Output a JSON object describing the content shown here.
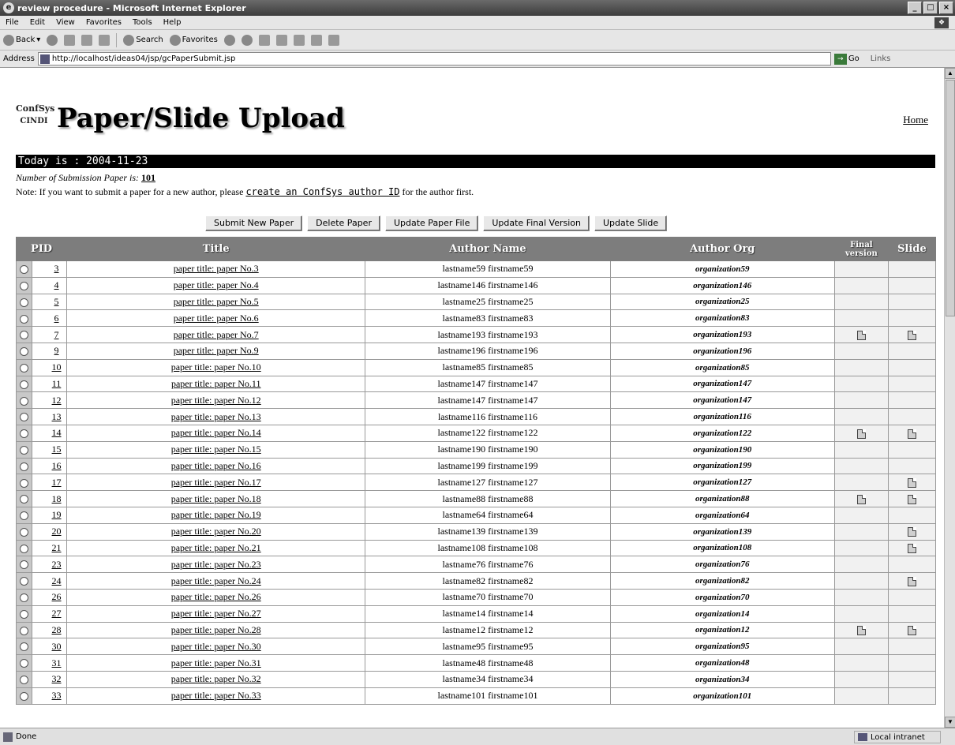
{
  "window": {
    "title": "review procedure - Microsoft Internet Explorer"
  },
  "menu": [
    "File",
    "Edit",
    "View",
    "Favorites",
    "Tools",
    "Help"
  ],
  "toolbar": {
    "back": "Back",
    "search": "Search",
    "favorites": "Favorites"
  },
  "address": {
    "label": "Address",
    "url": "http://localhost/ideas04/jsp/gcPaperSubmit.jsp",
    "go": "Go",
    "links": "Links"
  },
  "header": {
    "logo_line1": "ConfSys",
    "logo_line2": "CINDI",
    "title": "Paper/Slide Upload",
    "home": "Home"
  },
  "date_text": "Today is : 2004-11-23",
  "count": {
    "label": "Number of Submission Paper is:",
    "value": "101"
  },
  "note": {
    "prefix": "Note: If you want to submit a paper for a new author, please",
    "link": "create an ConfSys author ID",
    "suffix": "for the author first."
  },
  "buttons": [
    "Submit New Paper",
    "Delete Paper",
    "Update Paper File",
    "Update Final Version",
    "Update Slide"
  ],
  "table": {
    "headers": [
      "PID",
      "Title",
      "Author Name",
      "Author Org",
      "Final version",
      "Slide"
    ],
    "rows": [
      {
        "pid": "3",
        "title": "paper title: paper No.3",
        "author": "lastname59 firstname59",
        "org": "organization59",
        "final": false,
        "slide": false
      },
      {
        "pid": "4",
        "title": "paper title: paper No.4",
        "author": "lastname146 firstname146",
        "org": "organization146",
        "final": false,
        "slide": false
      },
      {
        "pid": "5",
        "title": "paper title: paper No.5",
        "author": "lastname25 firstname25",
        "org": "organization25",
        "final": false,
        "slide": false
      },
      {
        "pid": "6",
        "title": "paper title: paper No.6",
        "author": "lastname83 firstname83",
        "org": "organization83",
        "final": false,
        "slide": false
      },
      {
        "pid": "7",
        "title": "paper title: paper No.7",
        "author": "lastname193 firstname193",
        "org": "organization193",
        "final": true,
        "slide": true
      },
      {
        "pid": "9",
        "title": "paper title: paper No.9",
        "author": "lastname196 firstname196",
        "org": "organization196",
        "final": false,
        "slide": false
      },
      {
        "pid": "10",
        "title": "paper title: paper No.10",
        "author": "lastname85 firstname85",
        "org": "organization85",
        "final": false,
        "slide": false
      },
      {
        "pid": "11",
        "title": "paper title: paper No.11",
        "author": "lastname147 firstname147",
        "org": "organization147",
        "final": false,
        "slide": false
      },
      {
        "pid": "12",
        "title": "paper title: paper No.12",
        "author": "lastname147 firstname147",
        "org": "organization147",
        "final": false,
        "slide": false
      },
      {
        "pid": "13",
        "title": "paper title: paper No.13",
        "author": "lastname116 firstname116",
        "org": "organization116",
        "final": false,
        "slide": false
      },
      {
        "pid": "14",
        "title": "paper title: paper No.14",
        "author": "lastname122 firstname122",
        "org": "organization122",
        "final": true,
        "slide": true
      },
      {
        "pid": "15",
        "title": "paper title: paper No.15",
        "author": "lastname190 firstname190",
        "org": "organization190",
        "final": false,
        "slide": false
      },
      {
        "pid": "16",
        "title": "paper title: paper No.16",
        "author": "lastname199 firstname199",
        "org": "organization199",
        "final": false,
        "slide": false
      },
      {
        "pid": "17",
        "title": "paper title: paper No.17",
        "author": "lastname127 firstname127",
        "org": "organization127",
        "final": false,
        "slide": true
      },
      {
        "pid": "18",
        "title": "paper title: paper No.18",
        "author": "lastname88 firstname88",
        "org": "organization88",
        "final": true,
        "slide": true
      },
      {
        "pid": "19",
        "title": "paper title: paper No.19",
        "author": "lastname64 firstname64",
        "org": "organization64",
        "final": false,
        "slide": false
      },
      {
        "pid": "20",
        "title": "paper title: paper No.20",
        "author": "lastname139 firstname139",
        "org": "organization139",
        "final": false,
        "slide": true
      },
      {
        "pid": "21",
        "title": "paper title: paper No.21",
        "author": "lastname108 firstname108",
        "org": "organization108",
        "final": false,
        "slide": true
      },
      {
        "pid": "23",
        "title": "paper title: paper No.23",
        "author": "lastname76 firstname76",
        "org": "organization76",
        "final": false,
        "slide": false
      },
      {
        "pid": "24",
        "title": "paper title: paper No.24",
        "author": "lastname82 firstname82",
        "org": "organization82",
        "final": false,
        "slide": true
      },
      {
        "pid": "26",
        "title": "paper title: paper No.26",
        "author": "lastname70 firstname70",
        "org": "organization70",
        "final": false,
        "slide": false
      },
      {
        "pid": "27",
        "title": "paper title: paper No.27",
        "author": "lastname14 firstname14",
        "org": "organization14",
        "final": false,
        "slide": false
      },
      {
        "pid": "28",
        "title": "paper title: paper No.28",
        "author": "lastname12 firstname12",
        "org": "organization12",
        "final": true,
        "slide": true
      },
      {
        "pid": "30",
        "title": "paper title: paper No.30",
        "author": "lastname95 firstname95",
        "org": "organization95",
        "final": false,
        "slide": false
      },
      {
        "pid": "31",
        "title": "paper title: paper No.31",
        "author": "lastname48 firstname48",
        "org": "organization48",
        "final": false,
        "slide": false
      },
      {
        "pid": "32",
        "title": "paper title: paper No.32",
        "author": "lastname34 firstname34",
        "org": "organization34",
        "final": false,
        "slide": false
      },
      {
        "pid": "33",
        "title": "paper title: paper No.33",
        "author": "lastname101 firstname101",
        "org": "organization101",
        "final": false,
        "slide": false
      }
    ]
  },
  "status": {
    "left": "Done",
    "zone": "Local intranet"
  }
}
